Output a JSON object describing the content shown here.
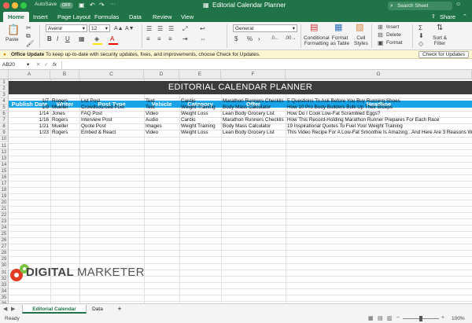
{
  "window": {
    "autosave": "AutoSave",
    "autosave_state": "OFF",
    "title": "Editorial Calendar Planner",
    "search_placeholder": "Search Sheet",
    "share": "Share"
  },
  "tabs": [
    "Home",
    "Insert",
    "Page Layout",
    "Formulas",
    "Data",
    "Review",
    "View"
  ],
  "ribbon": {
    "paste": "Paste",
    "font_name": "Avenir",
    "font_size": "12",
    "number_format": "General",
    "conditional": [
      "Conditional",
      "Formatting"
    ],
    "format_table": [
      "Format",
      "as Table"
    ],
    "cell_styles": [
      "Cell",
      "Styles"
    ],
    "insert": "Insert",
    "delete": "Delete",
    "format": "Format",
    "sort_filter": [
      "Sort &",
      "Filter"
    ]
  },
  "message": {
    "title": "Office Update",
    "text": "To keep up-to-date with security updates, fixes, and improvements, choose Check for Updates.",
    "button": "Check for Updates"
  },
  "formula_bar": {
    "name_box": "AB20",
    "fx": "fx"
  },
  "columns": [
    "A",
    "B",
    "C",
    "D",
    "E",
    "F",
    "G"
  ],
  "rows": [
    "1",
    "2",
    "3",
    "4",
    "5",
    "6",
    "7",
    "8",
    "9",
    "10",
    "11",
    "12",
    "13",
    "14",
    "15",
    "16",
    "17",
    "18",
    "19",
    "20",
    "21",
    "22",
    "23",
    "24",
    "25",
    "26",
    "27",
    "28",
    "29",
    "30",
    "31",
    "32",
    "33",
    "34",
    "35",
    "36"
  ],
  "sheet": {
    "banner": "EDITORIAL CALENDAR PLANNER",
    "headers": [
      "Publish Date",
      "Writer",
      "Post Type",
      "Vehicle",
      "Category",
      "Offer",
      "Headline"
    ],
    "data": [
      [
        "1/7",
        "Rogers",
        "List Post",
        "Text",
        "Cardio",
        "Marathon Runners Checklist",
        "5 Questions To Ask Before You Buy Running Shoes"
      ],
      [
        "1/9",
        "Mueller",
        "Crowdsourced Post",
        "Text",
        "Weight Training",
        "Body Mass Calculator",
        "How 10 Pro Body Builders Bulk Up Their Biceps"
      ],
      [
        "1/14",
        "Jones",
        "FAQ Post",
        "Video",
        "Weight Loss",
        "Lean Body Grocery List",
        "How Do I Cook Low-Fat Scrambled Eggs?"
      ],
      [
        "1/16",
        "Rogers",
        "Interview Post",
        "Audio",
        "Cardio",
        "Marathon Runners Checklist",
        "How This Record-Holding Marathon Runner Prepares For Each Race"
      ],
      [
        "1/21",
        "Mueller",
        "Quote Post",
        "Images",
        "Weight Training",
        "Body Mass Calculator",
        "19 Inspirational Quotes To Fuel Your Weight Training"
      ],
      [
        "1/23",
        "Rogers",
        "Embed & React",
        "Video",
        "Weight Loss",
        "Lean Body Grocery List",
        "This Video Recipe For A Low-Fat Smoothie Is Amazing...And Here Are 3 Reasons Why"
      ]
    ],
    "logo_a": "DIGITAL",
    "logo_b": "MARKETER"
  },
  "sheet_tabs": [
    "Editorial Calendar",
    "Data"
  ],
  "add_sheet": "+",
  "status": {
    "ready": "Ready",
    "zoom": "100%"
  },
  "colors": {
    "excel_green": "#1f7346",
    "header_blue": "#1aa4e8",
    "banner": "#3b3b3b",
    "logo_red": "#e23b24",
    "logo_green": "#7cc242"
  }
}
